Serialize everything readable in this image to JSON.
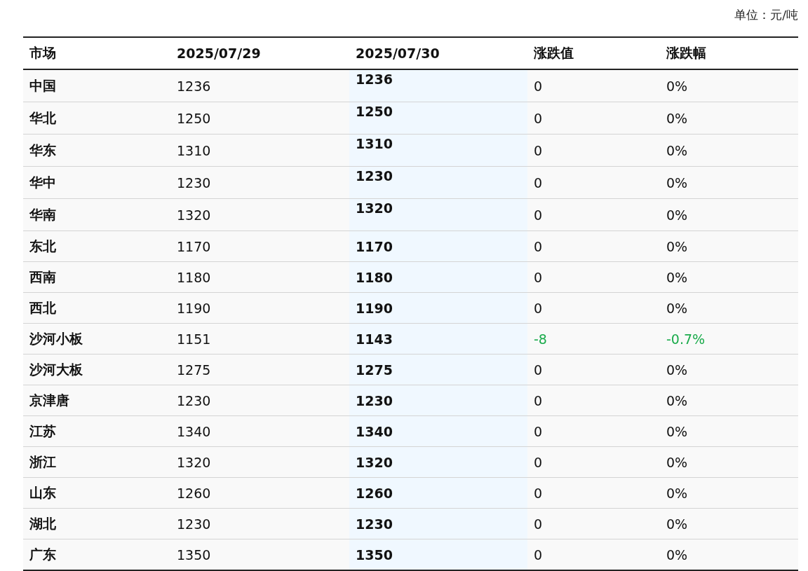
{
  "unit": "单位：元/吨",
  "columns": [
    "市场",
    "2025/07/29",
    "2025/07/30",
    "涨跌值",
    "涨跌幅"
  ],
  "rows": [
    {
      "market": "中国",
      "prev": "1236",
      "curr": "1236",
      "change": "0",
      "pct": "0%",
      "falling": false,
      "raised": true
    },
    {
      "market": "华北",
      "prev": "1250",
      "curr": "1250",
      "change": "0",
      "pct": "0%",
      "falling": false,
      "raised": true
    },
    {
      "market": "华东",
      "prev": "1310",
      "curr": "1310",
      "change": "0",
      "pct": "0%",
      "falling": false,
      "raised": true
    },
    {
      "market": "华中",
      "prev": "1230",
      "curr": "1230",
      "change": "0",
      "pct": "0%",
      "falling": false,
      "raised": true
    },
    {
      "market": "华南",
      "prev": "1320",
      "curr": "1320",
      "change": "0",
      "pct": "0%",
      "falling": false,
      "raised": true
    },
    {
      "market": "东北",
      "prev": "1170",
      "curr": "1170",
      "change": "0",
      "pct": "0%",
      "falling": false,
      "raised": false
    },
    {
      "market": "西南",
      "prev": "1180",
      "curr": "1180",
      "change": "0",
      "pct": "0%",
      "falling": false,
      "raised": false
    },
    {
      "market": "西北",
      "prev": "1190",
      "curr": "1190",
      "change": "0",
      "pct": "0%",
      "falling": false,
      "raised": false
    },
    {
      "market": "沙河小板",
      "prev": "1151",
      "curr": "1143",
      "change": "-8",
      "pct": "-0.7%",
      "falling": true,
      "raised": false
    },
    {
      "market": "沙河大板",
      "prev": "1275",
      "curr": "1275",
      "change": "0",
      "pct": "0%",
      "falling": false,
      "raised": false
    },
    {
      "market": "京津唐",
      "prev": "1230",
      "curr": "1230",
      "change": "0",
      "pct": "0%",
      "falling": false,
      "raised": false
    },
    {
      "market": "江苏",
      "prev": "1340",
      "curr": "1340",
      "change": "0",
      "pct": "0%",
      "falling": false,
      "raised": false
    },
    {
      "market": "浙江",
      "prev": "1320",
      "curr": "1320",
      "change": "0",
      "pct": "0%",
      "falling": false,
      "raised": false
    },
    {
      "market": "山东",
      "prev": "1260",
      "curr": "1260",
      "change": "0",
      "pct": "0%",
      "falling": false,
      "raised": false
    },
    {
      "market": "湖北",
      "prev": "1230",
      "curr": "1230",
      "change": "0",
      "pct": "0%",
      "falling": false,
      "raised": false
    },
    {
      "market": "广东",
      "prev": "1350",
      "curr": "1350",
      "change": "0",
      "pct": "0%",
      "falling": false,
      "raised": false
    }
  ]
}
